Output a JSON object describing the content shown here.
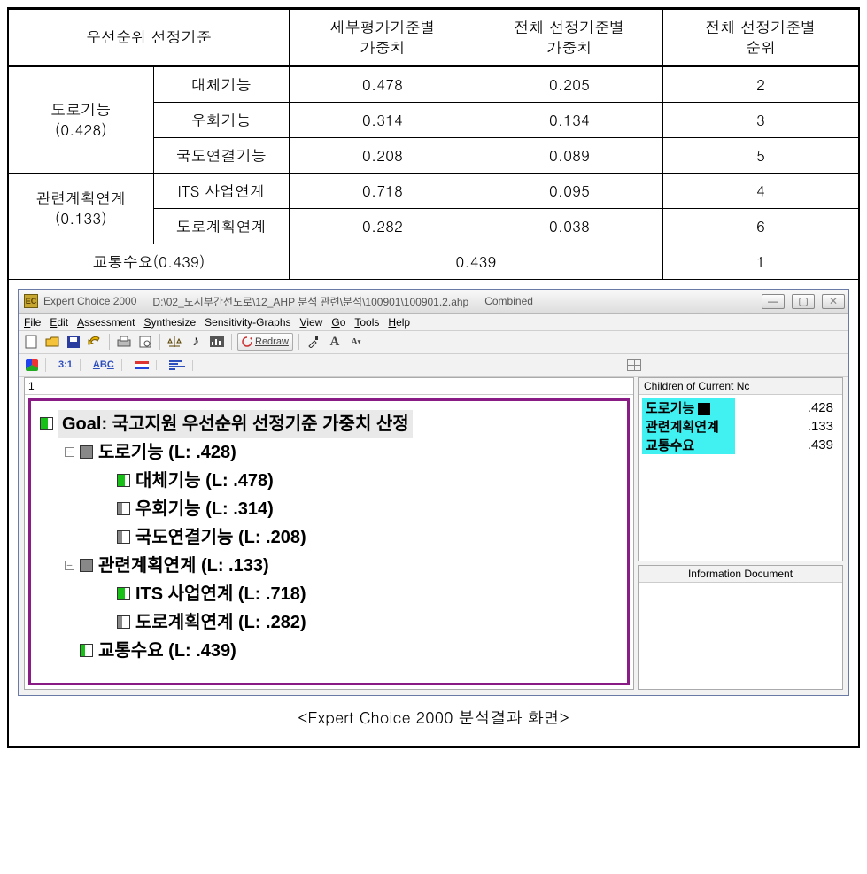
{
  "table": {
    "headers": {
      "c1": "우선순위 선정기준",
      "c2": "세부평가기준별\n가중치",
      "c3": "전체 선정기준별\n가중치",
      "c4": "전체 선정기준별\n순위"
    },
    "group1": {
      "title": "도로기능",
      "weight": "(0.428)",
      "rows": [
        {
          "sub": "대체기능",
          "w": "0.478",
          "gw": "0.205",
          "rank": "2"
        },
        {
          "sub": "우회기능",
          "w": "0.314",
          "gw": "0.134",
          "rank": "3"
        },
        {
          "sub": "국도연결기능",
          "w": "0.208",
          "gw": "0.089",
          "rank": "5"
        }
      ]
    },
    "group2": {
      "title": "관련계획연계",
      "weight": "(0.133)",
      "rows": [
        {
          "sub": "ITS 사업연계",
          "w": "0.718",
          "gw": "0.095",
          "rank": "4"
        },
        {
          "sub": "도로계획연계",
          "w": "0.282",
          "gw": "0.038",
          "rank": "6"
        }
      ]
    },
    "group3": {
      "label": "교통수요(0.439)",
      "gw": "0.439",
      "rank": "1"
    }
  },
  "ec": {
    "title": "Expert Choice 2000",
    "path": "D:\\02_도시부간선도로\\12_AHP 분석 관련\\분석\\100901\\100901.2.ahp",
    "mode": "Combined",
    "menu": {
      "file": "File",
      "edit": "Edit",
      "assessment": "Assessment",
      "synthesize": "Synthesize",
      "sensitivity": "Sensitivity-Graphs",
      "view": "View",
      "go": "Go",
      "tools": "Tools",
      "help": "Help"
    },
    "toolbar": {
      "redraw": "Redraw",
      "ratio": "3:1",
      "abc": "ABC"
    },
    "leftHeader": "1",
    "tree": {
      "goal": "Goal: 국고지원 우선순위 선정기준 가중치 산정",
      "n1": "도로기능 (L: .428)",
      "n1a": "대체기능 (L: .478)",
      "n1b": "우회기능 (L: .314)",
      "n1c": "국도연결기능 (L: .208)",
      "n2": "관련계획연계 (L: .133)",
      "n2a": "ITS 사업연계 (L: .718)",
      "n2b": "도로계획연계 (L: .282)",
      "n3": "교통수요 (L: .439)"
    },
    "childrenTitle": "Children of Current Nc",
    "children": [
      {
        "name": "도로기능",
        "val": ".428",
        "sel": true
      },
      {
        "name": "관련계획연계",
        "val": ".133",
        "sel": false
      },
      {
        "name": "교통수요",
        "val": ".439",
        "sel": false
      }
    ],
    "infoTitle": "Information Document"
  },
  "caption": "<Expert Choice 2000 분석결과 화면>"
}
